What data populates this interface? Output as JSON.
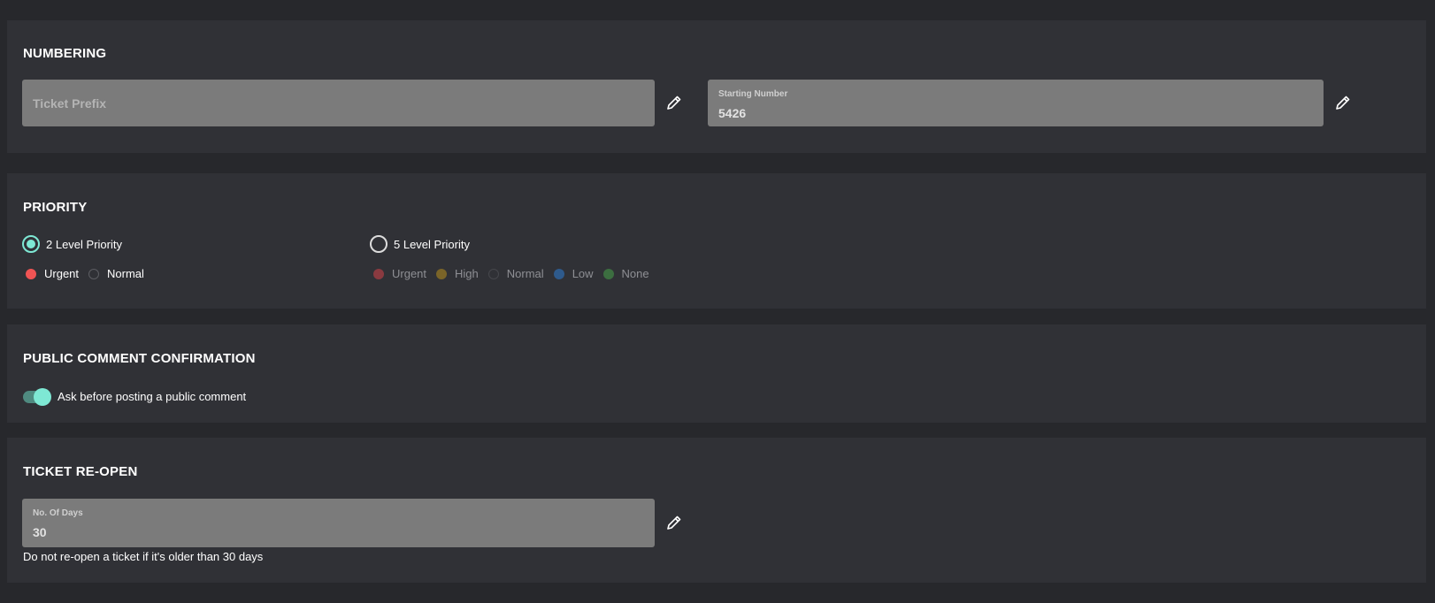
{
  "numbering": {
    "title": "NUMBERING",
    "ticket_prefix": {
      "placeholder": "Ticket Prefix",
      "value": ""
    },
    "starting_number": {
      "label": "Starting Number",
      "value": "5426"
    }
  },
  "priority": {
    "title": "PRIORITY",
    "options": [
      {
        "label": "2 Level Priority",
        "selected": true
      },
      {
        "label": "5 Level Priority",
        "selected": false
      }
    ],
    "two_level": [
      {
        "label": "Urgent",
        "color": "#f05454"
      },
      {
        "label": "Normal",
        "color": ""
      }
    ],
    "five_level": [
      {
        "label": "Urgent",
        "color": "#8a3a40"
      },
      {
        "label": "High",
        "color": "#7a6428"
      },
      {
        "label": "Normal",
        "color": ""
      },
      {
        "label": "Low",
        "color": "#2e5a8c"
      },
      {
        "label": "None",
        "color": "#3c6e40"
      }
    ]
  },
  "public_comment": {
    "title": "PUBLIC COMMENT CONFIRMATION",
    "toggle_on": true,
    "toggle_label": "Ask before posting a public comment"
  },
  "reopen": {
    "title": "TICKET RE-OPEN",
    "days": {
      "label": "No. Of Days",
      "value": "30"
    },
    "help": "Do not re-open a ticket if it's older than 30 days"
  },
  "colors": {
    "accent": "#7ee8d4",
    "panel": "#303136",
    "background": "#27282c",
    "field": "#7b7b7b"
  }
}
